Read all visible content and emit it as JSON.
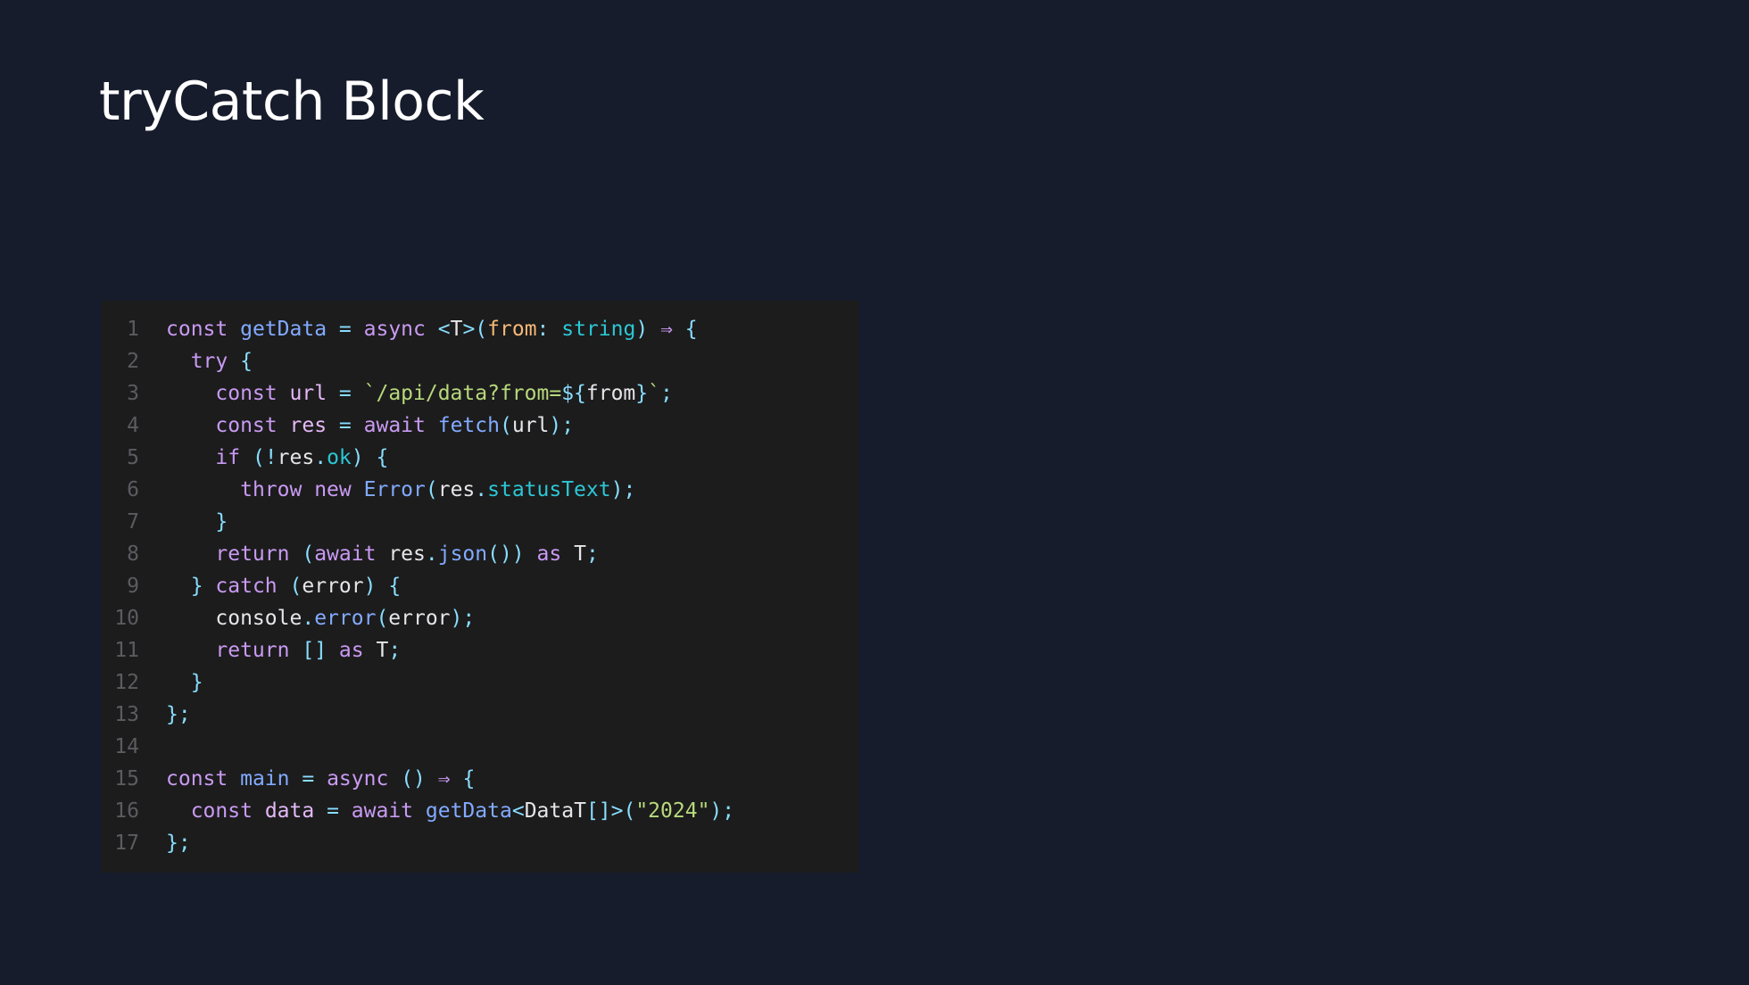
{
  "slide": {
    "title": "tryCatch Block"
  },
  "colors": {
    "background": "#171c2c",
    "code_background": "#1c1c1c",
    "keyword": "#c99af3",
    "function": "#82aaff",
    "variable": "#e4b9f7",
    "operator": "#89ddff",
    "parameter": "#f7b978",
    "type": "#2cc7d6",
    "string": "#b8d97c",
    "plain": "#e6e6ea",
    "line_number": "#5b5b60"
  },
  "code": {
    "language": "typescript",
    "lines": [
      {
        "number": "1",
        "tokens": [
          {
            "t": "kw",
            "v": "const"
          },
          {
            "t": "plain",
            "v": " "
          },
          {
            "t": "fn",
            "v": "getData"
          },
          {
            "t": "plain",
            "v": " "
          },
          {
            "t": "op",
            "v": "="
          },
          {
            "t": "plain",
            "v": " "
          },
          {
            "t": "kw",
            "v": "async"
          },
          {
            "t": "plain",
            "v": " "
          },
          {
            "t": "op",
            "v": "<"
          },
          {
            "t": "plain",
            "v": "T"
          },
          {
            "t": "op",
            "v": ">("
          },
          {
            "t": "param",
            "v": "from"
          },
          {
            "t": "op",
            "v": ":"
          },
          {
            "t": "plain",
            "v": " "
          },
          {
            "t": "type",
            "v": "string"
          },
          {
            "t": "op",
            "v": ")"
          },
          {
            "t": "plain",
            "v": " "
          },
          {
            "t": "kw",
            "v": "⇒"
          },
          {
            "t": "plain",
            "v": " "
          },
          {
            "t": "op",
            "v": "{"
          }
        ]
      },
      {
        "number": "2",
        "tokens": [
          {
            "t": "plain",
            "v": "  "
          },
          {
            "t": "kw",
            "v": "try"
          },
          {
            "t": "plain",
            "v": " "
          },
          {
            "t": "op",
            "v": "{"
          }
        ]
      },
      {
        "number": "3",
        "tokens": [
          {
            "t": "plain",
            "v": "    "
          },
          {
            "t": "kw",
            "v": "const"
          },
          {
            "t": "plain",
            "v": " "
          },
          {
            "t": "var",
            "v": "url"
          },
          {
            "t": "plain",
            "v": " "
          },
          {
            "t": "op",
            "v": "="
          },
          {
            "t": "plain",
            "v": " "
          },
          {
            "t": "str",
            "v": "`/api/data?from="
          },
          {
            "t": "op",
            "v": "${"
          },
          {
            "t": "plain",
            "v": "from"
          },
          {
            "t": "op",
            "v": "}"
          },
          {
            "t": "str",
            "v": "`"
          },
          {
            "t": "op",
            "v": ";"
          }
        ]
      },
      {
        "number": "4",
        "tokens": [
          {
            "t": "plain",
            "v": "    "
          },
          {
            "t": "kw",
            "v": "const"
          },
          {
            "t": "plain",
            "v": " "
          },
          {
            "t": "var",
            "v": "res"
          },
          {
            "t": "plain",
            "v": " "
          },
          {
            "t": "op",
            "v": "="
          },
          {
            "t": "plain",
            "v": " "
          },
          {
            "t": "kw",
            "v": "await"
          },
          {
            "t": "plain",
            "v": " "
          },
          {
            "t": "fn",
            "v": "fetch"
          },
          {
            "t": "op",
            "v": "("
          },
          {
            "t": "plain",
            "v": "url"
          },
          {
            "t": "op",
            "v": ");"
          }
        ]
      },
      {
        "number": "5",
        "tokens": [
          {
            "t": "plain",
            "v": "    "
          },
          {
            "t": "kw",
            "v": "if"
          },
          {
            "t": "plain",
            "v": " "
          },
          {
            "t": "op",
            "v": "(!"
          },
          {
            "t": "plain",
            "v": "res"
          },
          {
            "t": "op",
            "v": "."
          },
          {
            "t": "type",
            "v": "ok"
          },
          {
            "t": "op",
            "v": ")"
          },
          {
            "t": "plain",
            "v": " "
          },
          {
            "t": "op",
            "v": "{"
          }
        ]
      },
      {
        "number": "6",
        "tokens": [
          {
            "t": "plain",
            "v": "      "
          },
          {
            "t": "kw",
            "v": "throw"
          },
          {
            "t": "plain",
            "v": " "
          },
          {
            "t": "kw",
            "v": "new"
          },
          {
            "t": "plain",
            "v": " "
          },
          {
            "t": "fn",
            "v": "Error"
          },
          {
            "t": "op",
            "v": "("
          },
          {
            "t": "plain",
            "v": "res"
          },
          {
            "t": "op",
            "v": "."
          },
          {
            "t": "type",
            "v": "statusText"
          },
          {
            "t": "op",
            "v": ");"
          }
        ]
      },
      {
        "number": "7",
        "tokens": [
          {
            "t": "plain",
            "v": "    "
          },
          {
            "t": "op",
            "v": "}"
          }
        ]
      },
      {
        "number": "8",
        "tokens": [
          {
            "t": "plain",
            "v": "    "
          },
          {
            "t": "kw",
            "v": "return"
          },
          {
            "t": "plain",
            "v": " "
          },
          {
            "t": "op",
            "v": "("
          },
          {
            "t": "kw",
            "v": "await"
          },
          {
            "t": "plain",
            "v": " "
          },
          {
            "t": "plain",
            "v": "res"
          },
          {
            "t": "op",
            "v": "."
          },
          {
            "t": "fn",
            "v": "json"
          },
          {
            "t": "op",
            "v": "())"
          },
          {
            "t": "plain",
            "v": " "
          },
          {
            "t": "kw",
            "v": "as"
          },
          {
            "t": "plain",
            "v": " "
          },
          {
            "t": "plain",
            "v": "T"
          },
          {
            "t": "op",
            "v": ";"
          }
        ]
      },
      {
        "number": "9",
        "tokens": [
          {
            "t": "plain",
            "v": "  "
          },
          {
            "t": "op",
            "v": "}"
          },
          {
            "t": "plain",
            "v": " "
          },
          {
            "t": "kw",
            "v": "catch"
          },
          {
            "t": "plain",
            "v": " "
          },
          {
            "t": "op",
            "v": "("
          },
          {
            "t": "plain",
            "v": "error"
          },
          {
            "t": "op",
            "v": ")"
          },
          {
            "t": "plain",
            "v": " "
          },
          {
            "t": "op",
            "v": "{"
          }
        ]
      },
      {
        "number": "10",
        "tokens": [
          {
            "t": "plain",
            "v": "    "
          },
          {
            "t": "plain",
            "v": "console"
          },
          {
            "t": "op",
            "v": "."
          },
          {
            "t": "fn",
            "v": "error"
          },
          {
            "t": "op",
            "v": "("
          },
          {
            "t": "plain",
            "v": "error"
          },
          {
            "t": "op",
            "v": ");"
          }
        ]
      },
      {
        "number": "11",
        "tokens": [
          {
            "t": "plain",
            "v": "    "
          },
          {
            "t": "kw",
            "v": "return"
          },
          {
            "t": "plain",
            "v": " "
          },
          {
            "t": "op",
            "v": "[]"
          },
          {
            "t": "plain",
            "v": " "
          },
          {
            "t": "kw",
            "v": "as"
          },
          {
            "t": "plain",
            "v": " "
          },
          {
            "t": "plain",
            "v": "T"
          },
          {
            "t": "op",
            "v": ";"
          }
        ]
      },
      {
        "number": "12",
        "tokens": [
          {
            "t": "plain",
            "v": "  "
          },
          {
            "t": "op",
            "v": "}"
          }
        ]
      },
      {
        "number": "13",
        "tokens": [
          {
            "t": "op",
            "v": "};"
          }
        ]
      },
      {
        "number": "14",
        "tokens": []
      },
      {
        "number": "15",
        "tokens": [
          {
            "t": "kw",
            "v": "const"
          },
          {
            "t": "plain",
            "v": " "
          },
          {
            "t": "fn",
            "v": "main"
          },
          {
            "t": "plain",
            "v": " "
          },
          {
            "t": "op",
            "v": "="
          },
          {
            "t": "plain",
            "v": " "
          },
          {
            "t": "kw",
            "v": "async"
          },
          {
            "t": "plain",
            "v": " "
          },
          {
            "t": "op",
            "v": "()"
          },
          {
            "t": "plain",
            "v": " "
          },
          {
            "t": "kw",
            "v": "⇒"
          },
          {
            "t": "plain",
            "v": " "
          },
          {
            "t": "op",
            "v": "{"
          }
        ]
      },
      {
        "number": "16",
        "tokens": [
          {
            "t": "plain",
            "v": "  "
          },
          {
            "t": "kw",
            "v": "const"
          },
          {
            "t": "plain",
            "v": " "
          },
          {
            "t": "var",
            "v": "data"
          },
          {
            "t": "plain",
            "v": " "
          },
          {
            "t": "op",
            "v": "="
          },
          {
            "t": "plain",
            "v": " "
          },
          {
            "t": "kw",
            "v": "await"
          },
          {
            "t": "plain",
            "v": " "
          },
          {
            "t": "fn",
            "v": "getData"
          },
          {
            "t": "op",
            "v": "<"
          },
          {
            "t": "plain",
            "v": "DataT"
          },
          {
            "t": "op",
            "v": "[]>("
          },
          {
            "t": "str",
            "v": "\"2024\""
          },
          {
            "t": "op",
            "v": ");"
          }
        ]
      },
      {
        "number": "17",
        "tokens": [
          {
            "t": "op",
            "v": "};"
          }
        ]
      }
    ]
  }
}
